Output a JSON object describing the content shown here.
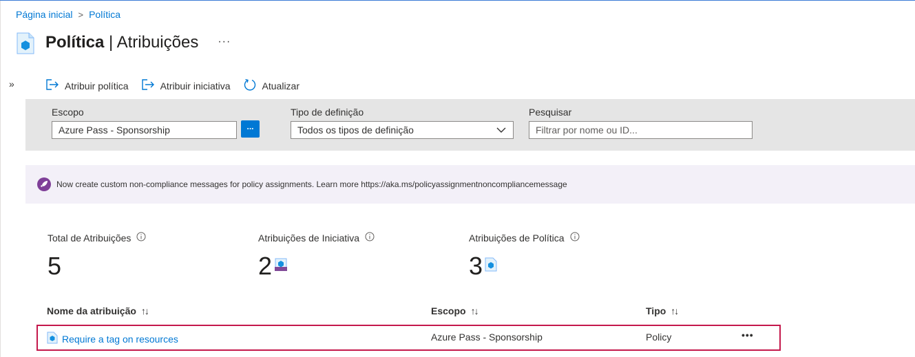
{
  "breadcrumb": {
    "home": "Página inicial",
    "separator": ">",
    "current": "Política"
  },
  "header": {
    "title_strong": "Política",
    "title_sub": " | Atribuições",
    "more": "···"
  },
  "nav": {
    "expand": "»"
  },
  "toolbar": {
    "assign_policy": "Atribuir política",
    "assign_initiative": "Atribuir iniciativa",
    "refresh": "Atualizar"
  },
  "filters": {
    "scope_label": "Escopo",
    "scope_value": "Azure Pass - Sponsorship",
    "scope_button": "...",
    "definition_type_label": "Tipo de definição",
    "definition_type_value": "Todos os tipos de definição",
    "search_label": "Pesquisar",
    "search_placeholder": "Filtrar por nome ou ID..."
  },
  "banner": {
    "message": "Now create custom non-compliance messages for policy assignments. Learn more https://aka.ms/policyassignmentnoncompliancemessage"
  },
  "stats": {
    "total_label": "Total de Atribuições",
    "total_value": "5",
    "initiative_label": "Atribuições de Iniciativa",
    "initiative_value": "2",
    "policy_label": "Atribuições de Política",
    "policy_value": "3"
  },
  "table": {
    "columns": [
      "Nome da atribuição",
      "Escopo",
      "Tipo"
    ],
    "sort_glyph": "↑↓",
    "rows": [
      {
        "name": "Require a tag on resources",
        "scope": "Azure Pass - Sponsorship",
        "type": "Policy",
        "more": "•••"
      }
    ]
  },
  "colors": {
    "accent": "#0078d4",
    "highlight_border": "#c4174b",
    "banner_bg": "#f3f0f8",
    "filter_bg": "#e5e5e5"
  }
}
